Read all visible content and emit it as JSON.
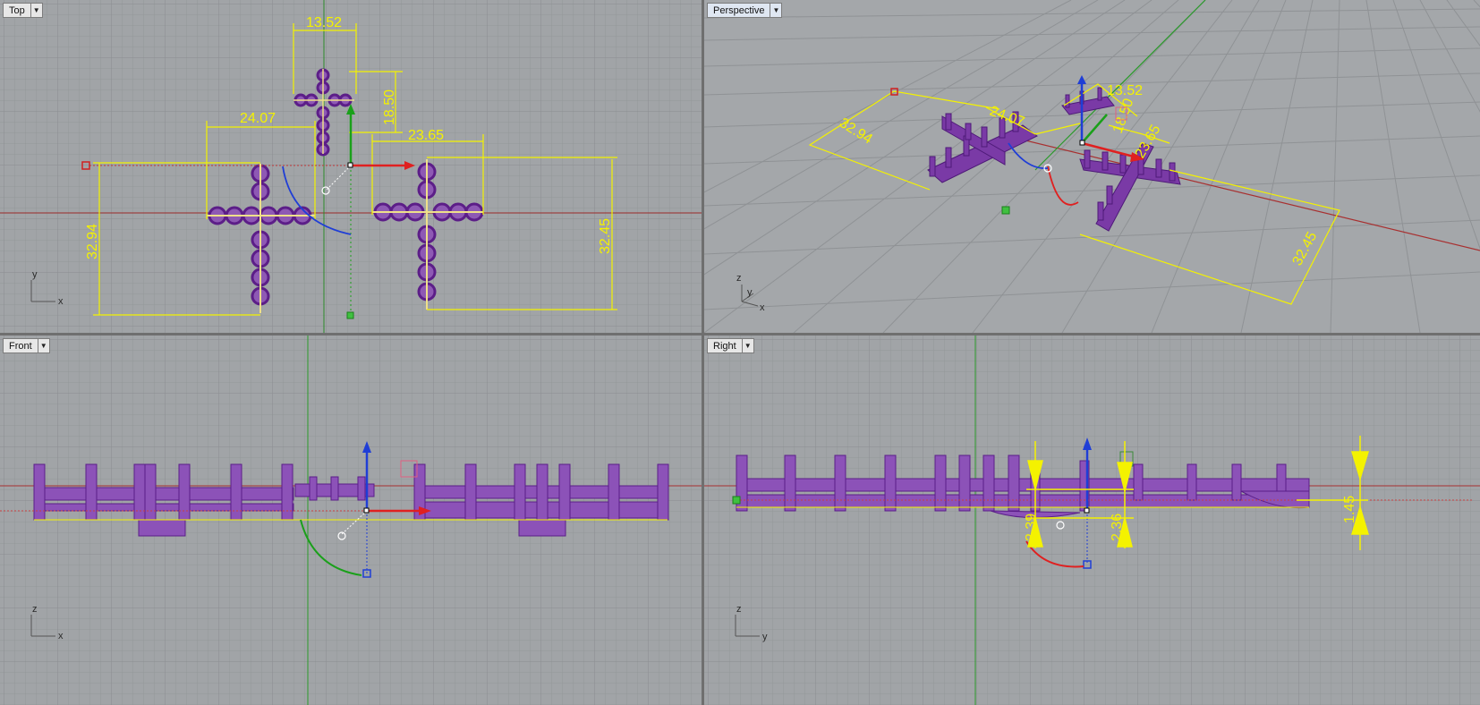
{
  "viewports": {
    "top": {
      "name": "Top",
      "dims": {
        "w1": "13.52",
        "h1": "18.50",
        "w2": "24.07",
        "w3": "23.65",
        "h2": "32.94",
        "h3": "32.45"
      },
      "axes": {
        "v": "y",
        "h": "x"
      }
    },
    "perspective": {
      "name": "Perspective",
      "dims": {
        "a": "32.94",
        "b": "24.07",
        "c": "13.52",
        "d": "18.50",
        "e": "23.65",
        "f": "32.45"
      },
      "axes": {
        "a": "z",
        "b": "y",
        "c": "x"
      }
    },
    "front": {
      "name": "Front",
      "axes": {
        "v": "z",
        "h": "x"
      }
    },
    "right": {
      "name": "Right",
      "dims": {
        "d1": "2.39",
        "d2": "2.36",
        "d3": "1.45"
      },
      "axes": {
        "v": "z",
        "h": "y"
      }
    }
  },
  "colors": {
    "background": "#a1a4a7",
    "grid_minor": "#949799",
    "grid_major": "#8a8d90",
    "dimension": "#f4f200",
    "object": "#7a3aa6",
    "x_axis": "#b02020",
    "y_axis": "#2a9a2a",
    "z_axis": "#1f3ed6"
  },
  "icons": {
    "dropdown": "caret-down-icon"
  }
}
